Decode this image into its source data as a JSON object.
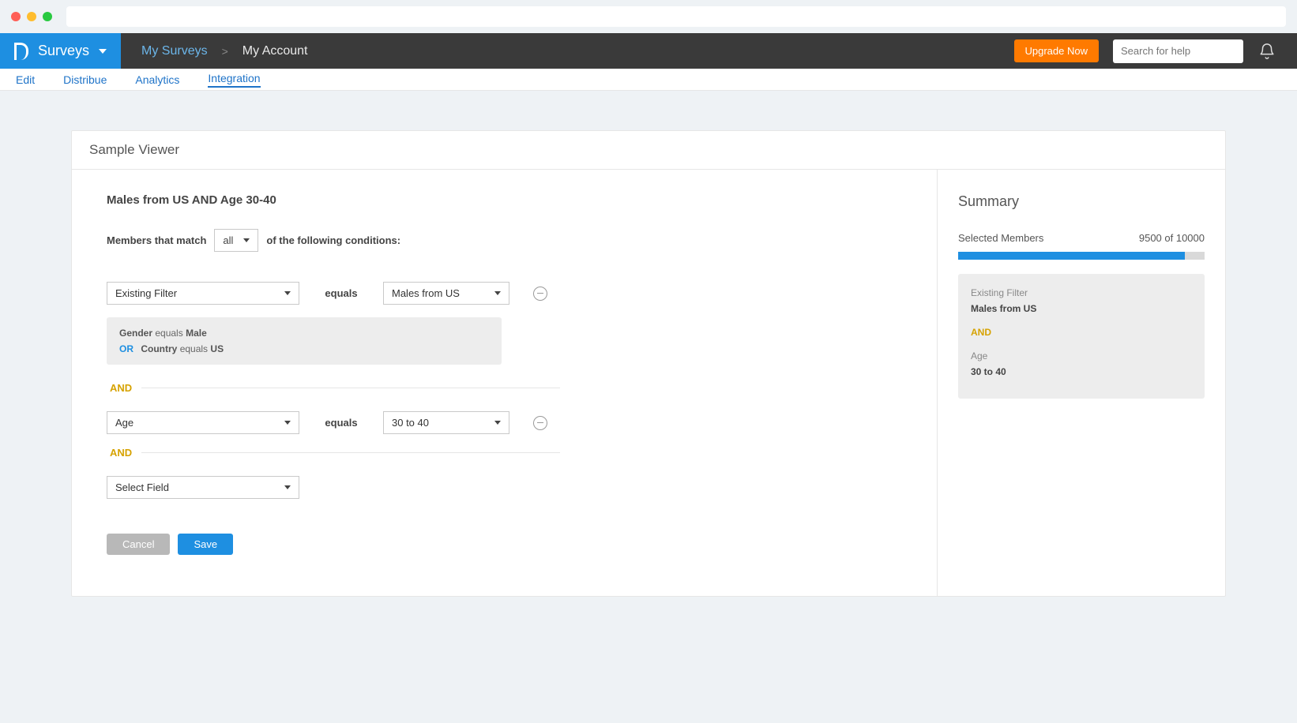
{
  "nav": {
    "brand": "Surveys",
    "breadcrumb_link": "My Surveys",
    "breadcrumb_sep": ">",
    "breadcrumb_current": "My Account",
    "upgrade_label": "Upgrade Now",
    "help_placeholder": "Search for help"
  },
  "subnav": {
    "edit": "Edit",
    "distribute": "Distribue",
    "analytics": "Analytics",
    "integration": "Integration"
  },
  "card": {
    "title": "Sample Viewer"
  },
  "filter": {
    "title": "Males from US AND Age 30-40",
    "match_prefix": "Members that match",
    "match_mode": "all",
    "match_suffix": "of the following conditions:",
    "cond1_field": "Existing Filter",
    "cond1_op": "equals",
    "cond1_value": "Males from US",
    "cond1_detail_l1_a": "Gender",
    "cond1_detail_l1_b": "equals",
    "cond1_detail_l1_c": "Male",
    "cond1_detail_l2_or": "OR",
    "cond1_detail_l2_a": "Country",
    "cond1_detail_l2_b": "equals",
    "cond1_detail_l2_c": "US",
    "and_label": "AND",
    "cond2_field": "Age",
    "cond2_op": "equals",
    "cond2_value": "30 to 40",
    "cond3_field": "Select Field",
    "cancel": "Cancel",
    "save": "Save"
  },
  "summary": {
    "title": "Summary",
    "members_label": "Selected Members",
    "members_value": "9500 of 10000",
    "box_l1_lbl": "Existing Filter",
    "box_l1_val": "Males from US",
    "box_and": "AND",
    "box_l2_lbl": "Age",
    "box_l2_val": "30 to 40"
  }
}
